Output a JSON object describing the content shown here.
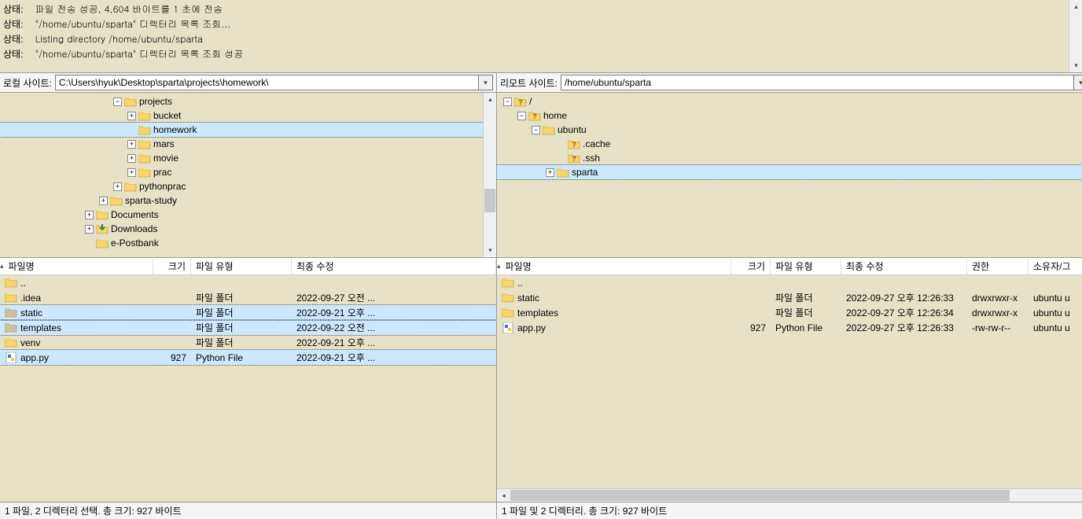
{
  "log": {
    "label": "상태:",
    "lines": [
      "파일 전송 성공, 4,604 바이트를 1 초에 전송",
      "\"/home/ubuntu/sparta\" 디렉터리 목록 조회...",
      "Listing directory /home/ubuntu/sparta",
      "\"/home/ubuntu/sparta\" 디렉터리 목록 조회 성공"
    ]
  },
  "local": {
    "site_label": "로컬 사이트:",
    "path": "C:\\Users\\hyuk\\Desktop\\sparta\\projects\\homework\\",
    "tree": [
      {
        "indent": 140,
        "twisty": "-",
        "q": false,
        "name": "projects"
      },
      {
        "indent": 158,
        "twisty": "+",
        "q": false,
        "name": "bucket"
      },
      {
        "indent": 158,
        "twisty": "",
        "q": false,
        "name": "homework",
        "selected": true
      },
      {
        "indent": 158,
        "twisty": "+",
        "q": false,
        "name": "mars"
      },
      {
        "indent": 158,
        "twisty": "+",
        "q": false,
        "name": "movie"
      },
      {
        "indent": 158,
        "twisty": "+",
        "q": false,
        "name": "prac"
      },
      {
        "indent": 140,
        "twisty": "+",
        "q": false,
        "name": "pythonprac"
      },
      {
        "indent": 122,
        "twisty": "+",
        "q": false,
        "name": "sparta-study"
      },
      {
        "indent": 104,
        "twisty": "+",
        "q": false,
        "name": "Documents"
      },
      {
        "indent": 104,
        "twisty": "+",
        "q": false,
        "name": "Downloads",
        "download": true
      },
      {
        "indent": 104,
        "twisty": "",
        "q": false,
        "name": "e-Postbank"
      }
    ],
    "headers": {
      "name": "파일명",
      "size": "크기",
      "type": "파일 유형",
      "modified": "최종 수정"
    },
    "cols": {
      "name": 195,
      "size": 48,
      "type": 128,
      "modified": 260
    },
    "rows": [
      {
        "icon": "folder",
        "name": "..",
        "size": "",
        "type": "",
        "modified": ""
      },
      {
        "icon": "folder",
        "name": ".idea",
        "size": "",
        "type": "파일 폴더",
        "modified": "2022-09-27 오전 ..."
      },
      {
        "icon": "folder-gray",
        "name": "static",
        "size": "",
        "type": "파일 폴더",
        "modified": "2022-09-21 오후 ...",
        "selected": true
      },
      {
        "icon": "folder-gray",
        "name": "templates",
        "size": "",
        "type": "파일 폴더",
        "modified": "2022-09-22 오전 ...",
        "selected": true
      },
      {
        "icon": "folder",
        "name": "venv",
        "size": "",
        "type": "파일 폴더",
        "modified": "2022-09-21 오후 ..."
      },
      {
        "icon": "py",
        "name": "app.py",
        "size": "927",
        "type": "Python File",
        "modified": "2022-09-21 오후 ...",
        "selected": true
      }
    ],
    "status": "1 파일, 2 디렉터리 선택. 총 크기: 927 바이트"
  },
  "remote": {
    "site_label": "리모트 사이트:",
    "path": "/home/ubuntu/sparta",
    "tree": [
      {
        "indent": 4,
        "twisty": "-",
        "q": true,
        "name": "/"
      },
      {
        "indent": 22,
        "twisty": "-",
        "q": true,
        "name": "home"
      },
      {
        "indent": 40,
        "twisty": "-",
        "q": false,
        "name": "ubuntu"
      },
      {
        "indent": 72,
        "twisty": "",
        "q": true,
        "name": ".cache"
      },
      {
        "indent": 72,
        "twisty": "",
        "q": true,
        "name": ".ssh"
      },
      {
        "indent": 58,
        "twisty": "+",
        "q": false,
        "name": "sparta",
        "selected": true
      }
    ],
    "headers": {
      "name": "파일명",
      "size": "크기",
      "type": "파일 유형",
      "modified": "최종 수정",
      "perm": "권한",
      "owner": "소유자/그"
    },
    "cols": {
      "name": 298,
      "size": 50,
      "type": 90,
      "modified": 160,
      "perm": 78,
      "owner": 80
    },
    "rows": [
      {
        "icon": "folder",
        "name": "..",
        "size": "",
        "type": "",
        "modified": "",
        "perm": "",
        "owner": ""
      },
      {
        "icon": "folder",
        "name": "static",
        "size": "",
        "type": "파일 폴더",
        "modified": "2022-09-27 오후 12:26:33",
        "perm": "drwxrwxr-x",
        "owner": "ubuntu u"
      },
      {
        "icon": "folder",
        "name": "templates",
        "size": "",
        "type": "파일 폴더",
        "modified": "2022-09-27 오후 12:26:34",
        "perm": "drwxrwxr-x",
        "owner": "ubuntu u"
      },
      {
        "icon": "py",
        "name": "app.py",
        "size": "927",
        "type": "Python File",
        "modified": "2022-09-27 오후 12:26:33",
        "perm": "-rw-rw-r--",
        "owner": "ubuntu u"
      }
    ],
    "status": "1 파일 및 2 디렉터리. 총 크기: 927 바이트"
  }
}
